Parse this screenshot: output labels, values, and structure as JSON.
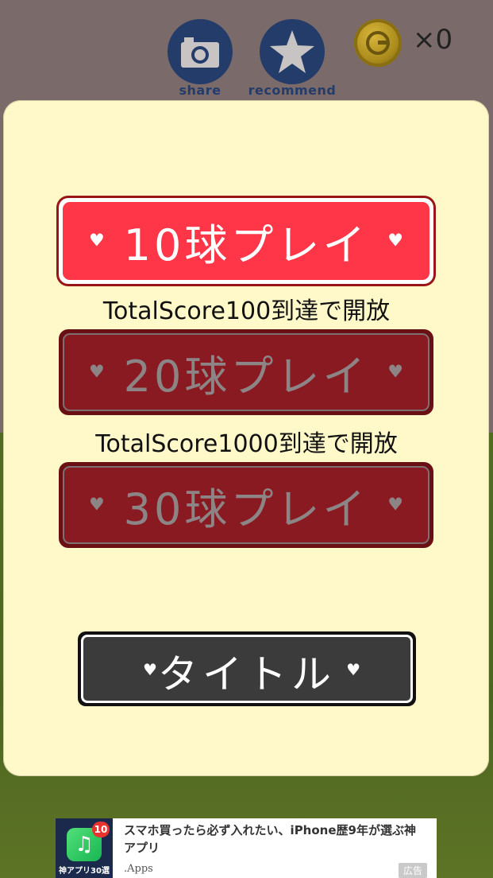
{
  "topbar": {
    "share_label": "share",
    "recommend_label": "recommend",
    "coin_count": "×0"
  },
  "menu": {
    "buttons": [
      {
        "label": "10球プレイ",
        "state": "unlocked"
      },
      {
        "label": "20球プレイ",
        "state": "locked"
      },
      {
        "label": "30球プレイ",
        "state": "locked"
      }
    ],
    "unlock_notes": [
      "TotalScore100到達で開放",
      "TotalScore1000到達で開放"
    ],
    "title_button_label": "タイトル"
  },
  "ad": {
    "icon_caption": "神アプリ30選",
    "badge": "10",
    "headline": "スマホ買ったら必ず入れたい、iPhone歴9年が選ぶ神アプリ",
    "source": ".Apps",
    "tag": "広告"
  },
  "colors": {
    "active_button": "#ff3548",
    "locked_button": "#8a1a22",
    "panel": "#fff8c8",
    "round_button": "#243c69"
  }
}
